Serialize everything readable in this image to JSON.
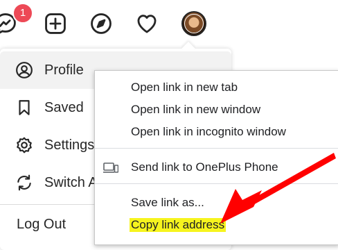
{
  "topbar": {
    "messenger_badge": "1",
    "icons": [
      "messenger-icon",
      "new-post-icon",
      "explore-compass-icon",
      "activity-heart-icon",
      "profile-avatar"
    ]
  },
  "profile_menu": {
    "items": [
      {
        "label": "Profile",
        "icon": "person-circle-icon"
      },
      {
        "label": "Saved",
        "icon": "bookmark-icon"
      },
      {
        "label": "Settings",
        "icon": "gear-icon"
      },
      {
        "label": "Switch Accounts",
        "icon": "switch-arrows-icon"
      }
    ],
    "logout_label": "Log Out"
  },
  "context_menu": {
    "items": [
      {
        "label": "Open link in new tab"
      },
      {
        "label": "Open link in new window"
      },
      {
        "label": "Open link in incognito window"
      },
      {
        "label": "Send link to OnePlus Phone",
        "icon": "devices-icon"
      },
      {
        "label": "Save link as..."
      },
      {
        "label": "Copy link address",
        "highlighted": true
      }
    ]
  },
  "colors": {
    "badge": "#ed4956",
    "highlight": "#f6f41e",
    "annotation_arrow": "#ff0000"
  }
}
